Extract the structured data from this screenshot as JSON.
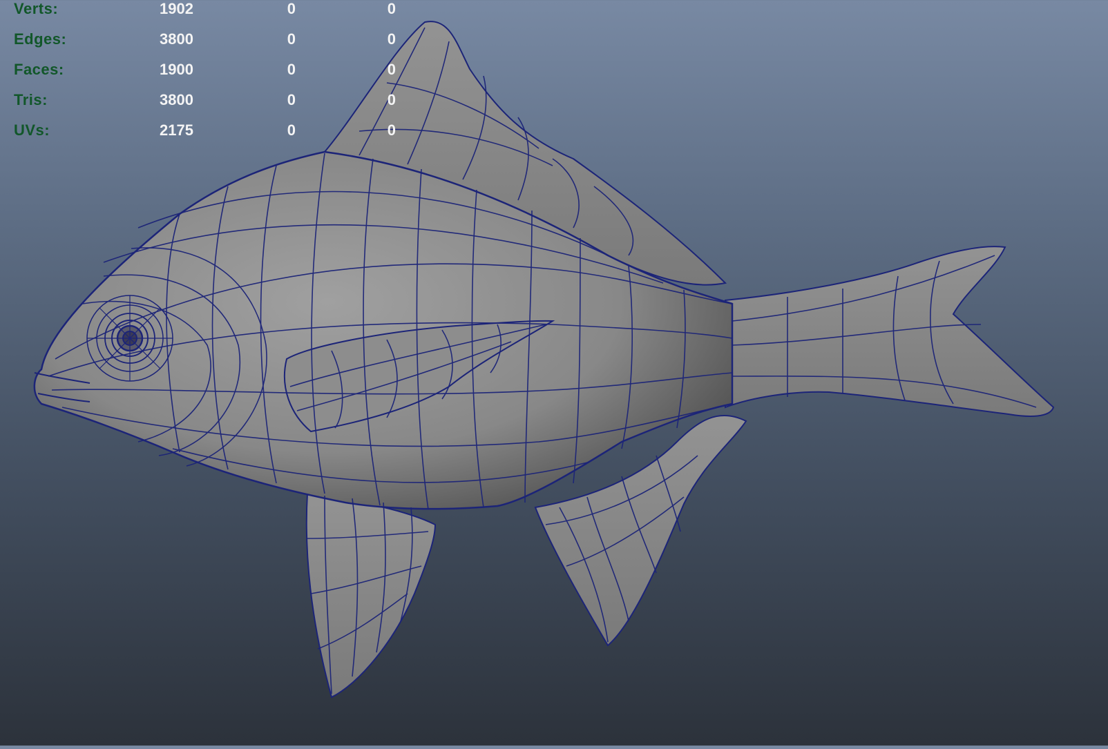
{
  "hud": {
    "rows": [
      {
        "label": "Verts:",
        "count": "1902",
        "selected": "0",
        "selected_components": "0"
      },
      {
        "label": "Edges:",
        "count": "3800",
        "selected": "0",
        "selected_components": "0"
      },
      {
        "label": "Faces:",
        "count": "1900",
        "selected": "0",
        "selected_components": "0"
      },
      {
        "label": "Tris:",
        "count": "3800",
        "selected": "0",
        "selected_components": "0"
      },
      {
        "label": "UVs:",
        "count": "2175",
        "selected": "0",
        "selected_components": "0"
      }
    ]
  },
  "viewport": {
    "background_top": "#7889a3",
    "background_bottom": "#2c323b",
    "mesh_fill": "#8a8a8a",
    "wire_color": "#1c2478"
  }
}
